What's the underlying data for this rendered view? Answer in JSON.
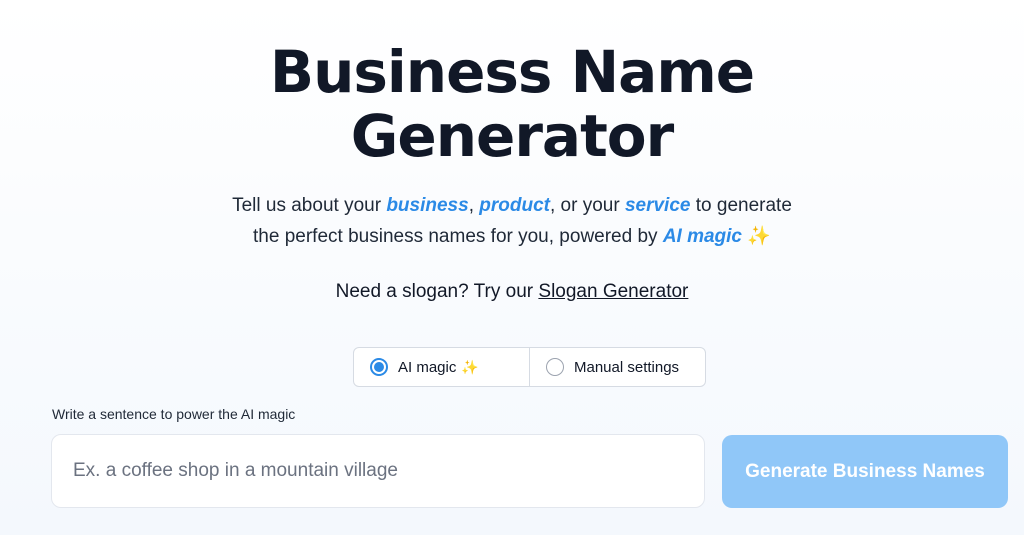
{
  "hero": {
    "title_line1": "Business Name",
    "title_line2": "Generator"
  },
  "subtitle": {
    "part1": "Tell us about your ",
    "kw_business": "business",
    "sep1": ", ",
    "kw_product": "product",
    "part2": ", or your ",
    "kw_service": "service",
    "part3": " to generate",
    "part4": "the perfect business names for you, powered by ",
    "kw_ai_magic": "AI magic",
    "sparkle": "✨"
  },
  "slogan": {
    "prefix": "Need a slogan? Try our ",
    "link_label": "Slogan Generator"
  },
  "mode_toggle": {
    "selected": "ai_magic",
    "ai_magic_label": "AI magic",
    "ai_magic_sparkle": "✨",
    "manual_label": "Manual settings"
  },
  "prompt": {
    "label": "Write a sentence to power the AI magic",
    "value": "",
    "placeholder": "Ex. a coffee shop in a mountain village"
  },
  "generate_button": {
    "label": "Generate Business Names"
  },
  "colors": {
    "accent": "#2b8ae6",
    "button_disabled": "#90c7f8",
    "title": "#111827"
  }
}
